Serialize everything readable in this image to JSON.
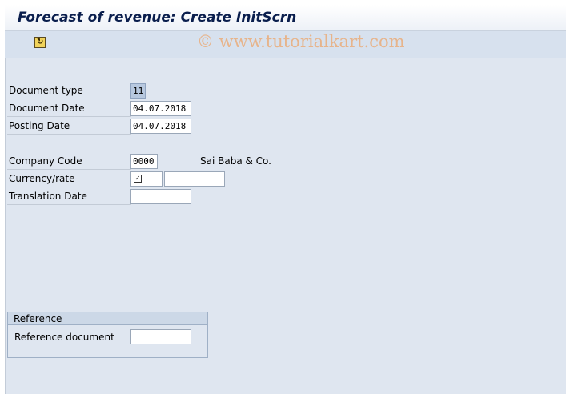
{
  "window": {
    "title": "Forecast of revenue: Create InitScrn"
  },
  "toolbar": {
    "icon": "execute-icon"
  },
  "watermark": {
    "text": "© www.tutorialkart.com"
  },
  "form": {
    "document_type": {
      "label": "Document type",
      "value": "11"
    },
    "document_date": {
      "label": "Document Date",
      "value": "04.07.2018"
    },
    "posting_date": {
      "label": "Posting Date",
      "value": "04.07.2018"
    },
    "company_code": {
      "label": "Company Code",
      "value": "0000",
      "description": "Sai Baba & Co."
    },
    "currency_rate": {
      "label": "Currency/rate",
      "currency_value": "",
      "rate_value": ""
    },
    "translation_date": {
      "label": "Translation Date",
      "value": ""
    }
  },
  "reference": {
    "title": "Reference",
    "reference_document": {
      "label": "Reference document",
      "value": ""
    }
  }
}
